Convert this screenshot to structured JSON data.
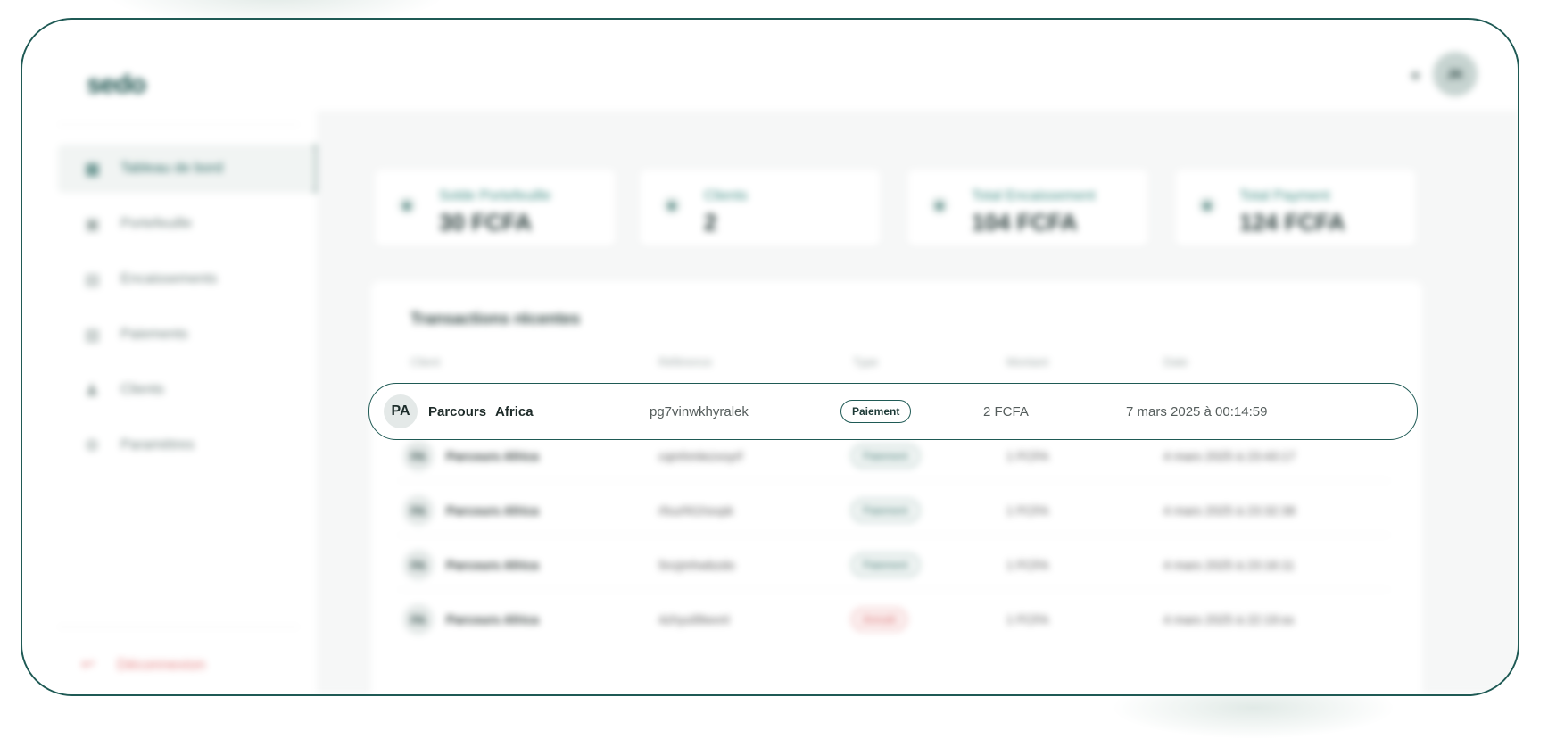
{
  "brand": {
    "logo": "sedo"
  },
  "sidebar": {
    "items": [
      {
        "label": "Tableau de bord",
        "icon": "chart-icon",
        "active": true
      },
      {
        "label": "Portefeuille",
        "icon": "wallet-icon",
        "active": false
      },
      {
        "label": "Encaissements",
        "icon": "cash-icon",
        "active": false
      },
      {
        "label": "Paiements",
        "icon": "card-icon",
        "active": false
      },
      {
        "label": "Clients",
        "icon": "users-icon",
        "active": false
      },
      {
        "label": "Paramètres",
        "icon": "gear-icon",
        "active": false
      }
    ],
    "logout": "Déconnexion"
  },
  "header": {
    "user_initials": "JK"
  },
  "stats": [
    {
      "label": "Solde Portefeuille",
      "value": "30 FCFA"
    },
    {
      "label": "Clients",
      "value": "2"
    },
    {
      "label": "Total Encaissement",
      "value": "104 FCFA"
    },
    {
      "label": "Total Payment",
      "value": "124 FCFA"
    }
  ],
  "transactions": {
    "title": "Transactions récentes",
    "columns": [
      "Client",
      "Référence",
      "Type",
      "Montant",
      "Date"
    ],
    "focused_row": {
      "initials": "PA",
      "client_first": "Parcours",
      "client_last": "Africa",
      "reference": "pg7vinwkhyralek",
      "type": "Paiement",
      "amount": "2 FCFA",
      "date": "7 mars 2025 à 00:14:59"
    },
    "rows": [
      {
        "initials": "PA",
        "client": "Parcours  Africa",
        "reference": "cqmhmlezxoyrf",
        "type": "Paiement",
        "amount": "1 FCFA",
        "date": "4 mars 2025 à 23:43:17"
      },
      {
        "initials": "PA",
        "client": "Parcours  Africa",
        "reference": "rfxurf41hsvpk",
        "type": "Paiement",
        "amount": "1 FCFA",
        "date": "4 mars 2025 à 23:32:38"
      },
      {
        "initials": "PA",
        "client": "Parcours  Africa",
        "reference": "5nzjmhwbzdo",
        "type": "Paiement",
        "amount": "1 FCFA",
        "date": "4 mars 2025 à 23:16:11"
      },
      {
        "initials": "PA",
        "client": "Parcours  Africa",
        "reference": "4zhyul9lwvnl",
        "type": "Annulé",
        "amount": "1 FCFA",
        "date": "4 mars 2025 à 22:19:ss"
      }
    ]
  },
  "colors": {
    "frame": "#1f5a55",
    "accent": "#2c6a64",
    "danger": "#e58585"
  }
}
